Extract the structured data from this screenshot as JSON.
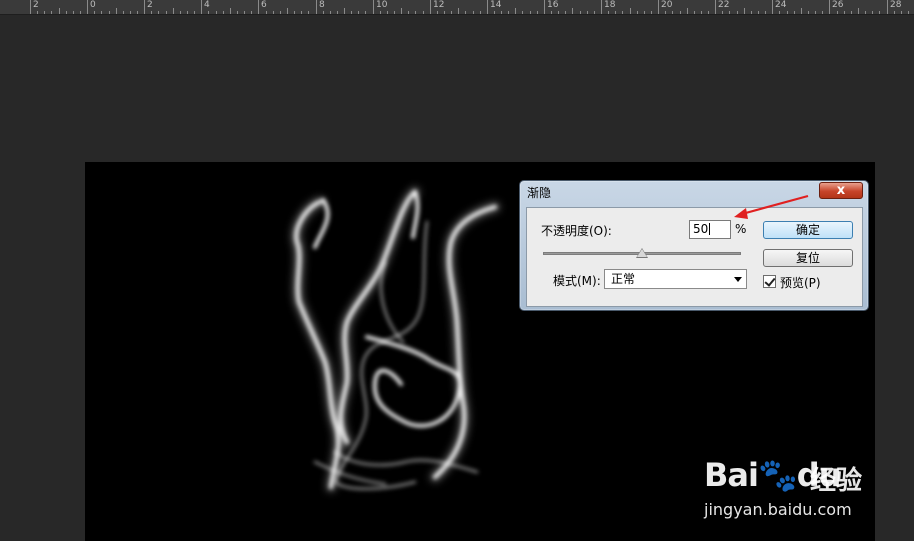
{
  "ruler": {
    "labels": [
      "2",
      "0",
      "2",
      "4",
      "6",
      "8",
      "10",
      "12",
      "14",
      "16",
      "18",
      "20",
      "22",
      "24",
      "26",
      "28"
    ]
  },
  "dialog": {
    "title": "渐隐",
    "close_label": "x",
    "opacity_label": "不透明度(O):",
    "opacity_value": "50",
    "opacity_unit": "%",
    "mode_label": "模式(M):",
    "mode_value": "正常",
    "ok_label": "确定",
    "reset_label": "复位",
    "preview_label": "预览(P)",
    "preview_checked": true
  },
  "slider": {
    "value": 50,
    "min": 0,
    "max": 100
  },
  "watermark": {
    "logo": "Bai",
    "logo2": "du",
    "jingyan": "经验",
    "url": "jingyan.baidu.com"
  },
  "colors": {
    "workspace": "#282828",
    "canvas": "#000000",
    "annotation_arrow": "#e02020",
    "close_button": "#c7442a"
  }
}
